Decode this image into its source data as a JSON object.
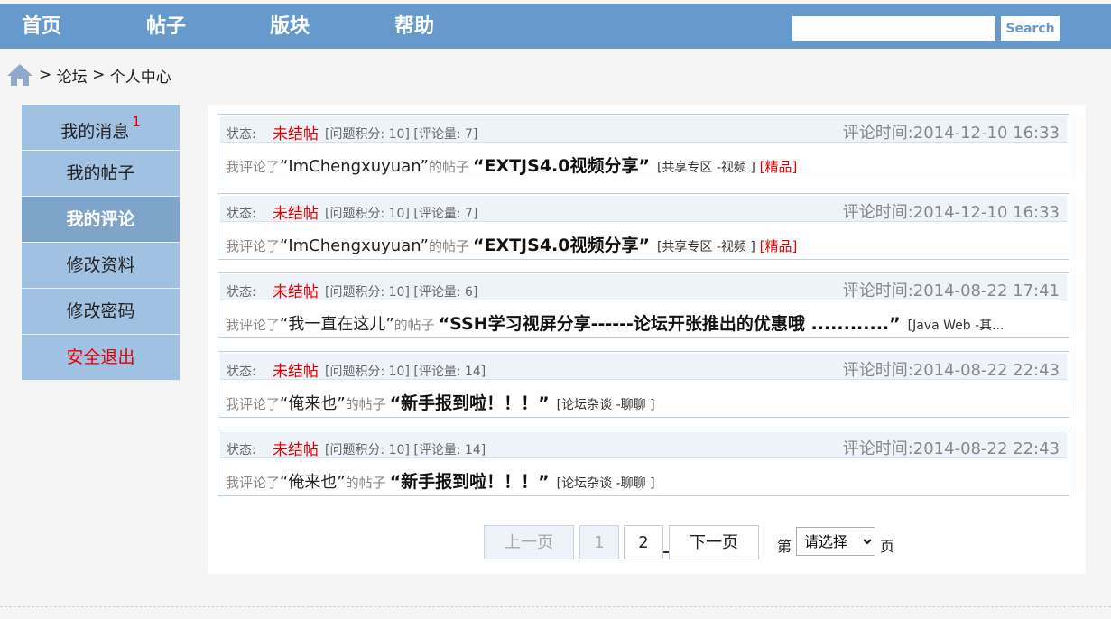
{
  "nav": {
    "items": [
      "首页",
      "帖子",
      "版块",
      "帮助"
    ],
    "search_placeholder": "",
    "search_label": "Search"
  },
  "breadcrumb": {
    "separator": ">",
    "items": [
      "论坛",
      "个人中心"
    ]
  },
  "sidebar": {
    "items": [
      {
        "label": "我的消息",
        "badge": "1"
      },
      {
        "label": "我的帖子"
      },
      {
        "label": "我的评论",
        "active": true
      },
      {
        "label": "修改资料"
      },
      {
        "label": "修改密码"
      },
      {
        "label": "安全退出"
      }
    ]
  },
  "comments": {
    "status_label": "状态:",
    "prefix": "我评论了",
    "of_post": "的帖子",
    "items": [
      {
        "status": "未结帖",
        "meta": "[问题积分: 10] [评论量: 7]",
        "time": "评论时间:2014-12-10 16:33",
        "user": "“ImChengxuyuan”",
        "title": "“EXTJS4.0视频分享”",
        "board": "[共享专区 -视频 ]",
        "tag": "[精品]"
      },
      {
        "status": "未结帖",
        "meta": "[问题积分: 10] [评论量: 7]",
        "time": "评论时间:2014-12-10 16:33",
        "user": "“ImChengxuyuan”",
        "title": "“EXTJS4.0视频分享”",
        "board": "[共享专区 -视频 ]",
        "tag": "[精品]"
      },
      {
        "status": "未结帖",
        "meta": "[问题积分: 10] [评论量: 6]",
        "time": "评论时间:2014-08-22 17:41",
        "user": "“我一直在这儿”",
        "title": "“SSH学习视屏分享------论坛开张推出的优惠哦 ............”",
        "board": "[Java Web -其...",
        "tag": ""
      },
      {
        "status": "未结帖",
        "meta": "[问题积分: 10] [评论量: 14]",
        "time": "评论时间:2014-08-22 22:43",
        "user": "“俺来也”",
        "title": "“新手报到啦！！！”",
        "board": "[论坛杂谈 -聊聊 ]",
        "tag": ""
      },
      {
        "status": "未结帖",
        "meta": "[问题积分: 10] [评论量: 14]",
        "time": "评论时间:2014-08-22 22:43",
        "user": "“俺来也”",
        "title": "“新手报到啦！！！”",
        "board": "[论坛杂谈 -聊聊 ]",
        "tag": ""
      }
    ]
  },
  "pager": {
    "prev": "上一页",
    "pages": [
      "1",
      "2"
    ],
    "next": "下一页",
    "di": "第",
    "select_value": "请选择",
    "ye": "页"
  },
  "colors": {
    "header": "#6699cc",
    "sidebar": "#a1c1e2",
    "sidebar_active": "#7fa4c9",
    "accent_red": "#e60000"
  }
}
